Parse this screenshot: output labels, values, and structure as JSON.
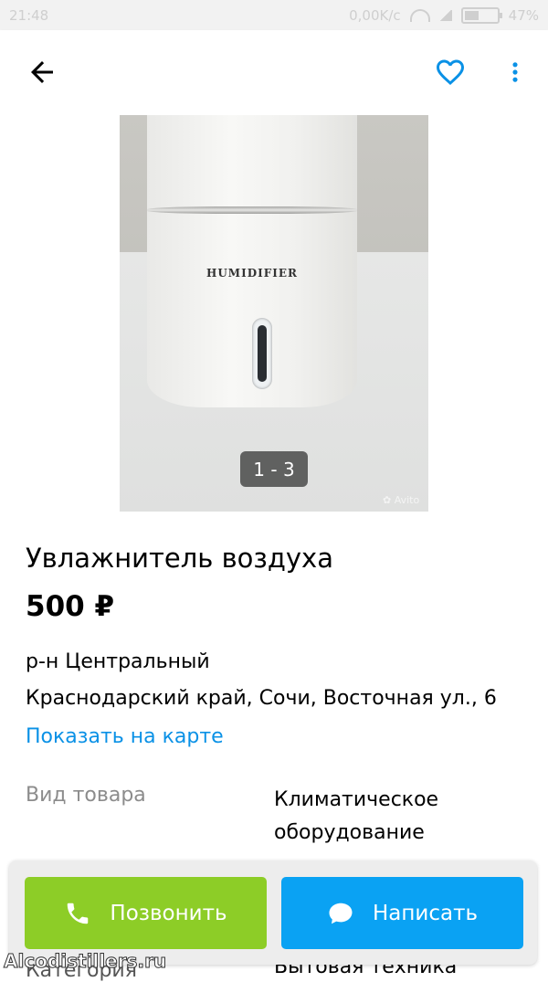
{
  "status_bar": {
    "time": "21:48",
    "speed": "0,00K/c",
    "battery": "47%",
    "battery_level": 0.47
  },
  "toolbar": {
    "back_icon": "arrow-left-icon",
    "favorite_icon": "heart-outline-icon",
    "more_icon": "more-vertical-icon",
    "accent_color": "#0a91e6"
  },
  "gallery": {
    "product_brand_text": "HUMIDIFIER",
    "counter": "1 - 3",
    "watermark": "Avito"
  },
  "listing": {
    "title": "Увлажнитель воздуха",
    "price": "500 ₽",
    "district": "р-н Центральный",
    "address": "Краснодарский край, Сочи, Восточная ул., 6",
    "map_link": "Показать на карте"
  },
  "params": [
    {
      "label": "Вид товара",
      "value": "Климатическое оборудование"
    },
    {
      "label": "Категория",
      "value": "Бытовая техника"
    }
  ],
  "actions": {
    "call_label": "Позвонить",
    "call_color": "#8dcd27",
    "write_label": "Написать",
    "write_color": "#0aa2f3"
  },
  "overlay": {
    "site": "Alcodistillers.ru"
  }
}
